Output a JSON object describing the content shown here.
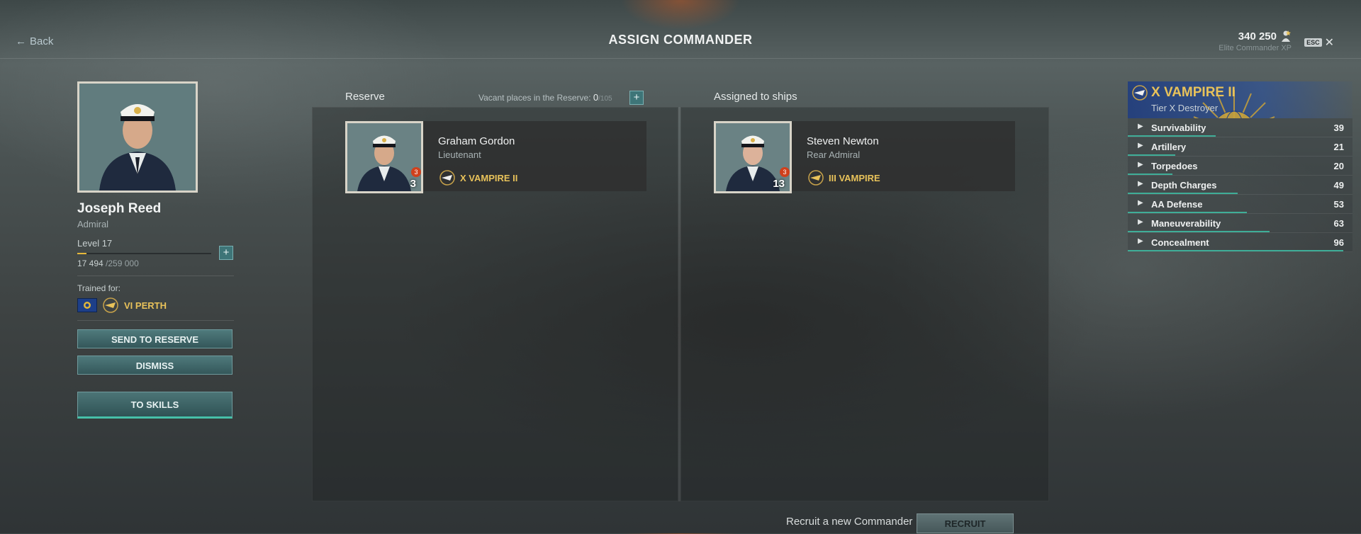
{
  "header": {
    "back_label": "Back",
    "title": "ASSIGN COMMANDER",
    "xp_value": "340 250",
    "xp_label": "Elite Commander XP",
    "esc_label": "ESC",
    "close_icon": "close-icon"
  },
  "commander": {
    "name": "Joseph Reed",
    "rank": "Admiral",
    "level": "Level 17",
    "xp_current": "17 494",
    "xp_total": "/259 000",
    "xp_progress": 0.0675,
    "trained_label": "Trained for:",
    "trained_ship": "VI PERTH",
    "buttons": {
      "reserve": "SEND TO RESERVE",
      "dismiss": "DISMISS",
      "skills": "TO SKILLS"
    }
  },
  "reserve": {
    "heading": "Reserve",
    "vacant_label": "Vacant places in the Reserve:",
    "vacant_current": "0",
    "vacant_total": "/105",
    "cards": [
      {
        "name": "Graham Gordon",
        "rank": "Lieutenant",
        "level": "3",
        "badge": "3",
        "ship": "X VAMPIRE II"
      }
    ]
  },
  "assigned": {
    "heading": "Assigned to ships",
    "cards": [
      {
        "name": "Steven Newton",
        "rank": "Rear Admiral",
        "level": "13",
        "badge": "3",
        "ship": "III VAMPIRE"
      }
    ]
  },
  "ship": {
    "name": "X VAMPIRE II",
    "tier": "Tier X Destroyer",
    "stats": [
      {
        "name": "Survivability",
        "value": "39",
        "fraction": 0.39
      },
      {
        "name": "Artillery",
        "value": "21",
        "fraction": 0.21
      },
      {
        "name": "Torpedoes",
        "value": "20",
        "fraction": 0.2
      },
      {
        "name": "Depth Charges",
        "value": "49",
        "fraction": 0.49
      },
      {
        "name": "AA Defense",
        "value": "53",
        "fraction": 0.53
      },
      {
        "name": "Maneuverability",
        "value": "63",
        "fraction": 0.63
      },
      {
        "name": "Concealment",
        "value": "96",
        "fraction": 0.96
      }
    ]
  },
  "footer": {
    "recruit_text": "Recruit a new Commander",
    "recruit_button": "RECRUIT"
  },
  "colors": {
    "accent_gold": "#e8c25a",
    "teal_button": "#3e7578",
    "stat_bar": "#3fae98",
    "badge_red": "#d0401c"
  }
}
